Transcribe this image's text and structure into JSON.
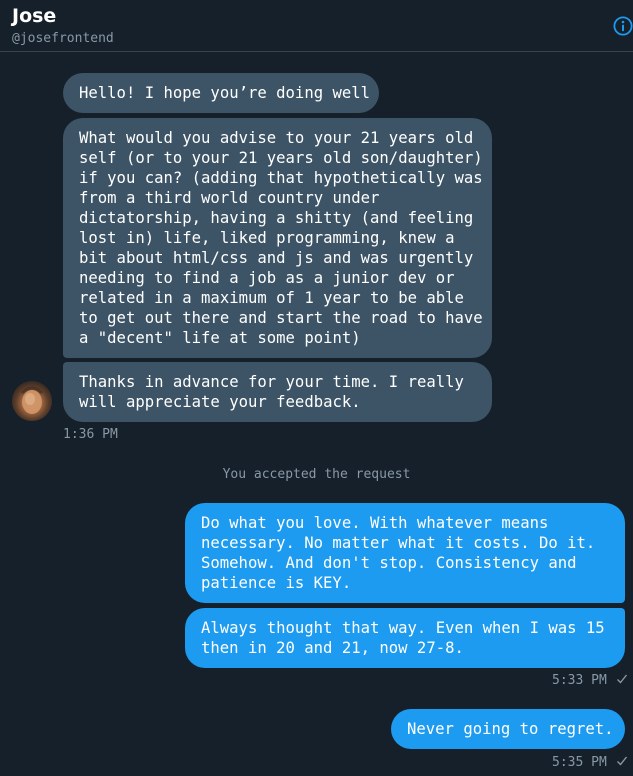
{
  "header": {
    "name": "Jose",
    "handle": "@josefrontend",
    "info_icon": "info-icon"
  },
  "incoming": {
    "messages": [
      "Hello! I hope you’re doing well",
      "What would you advise to your 21 years old\nself (or to your 21 years old son/daughter)\nif you can? (adding that hypothetically was\nfrom a third world country under\ndictatorship, having a shitty (and feeling\nlost in) life, liked programming, knew a\nbit about html/css and js and was urgently\nneeding to find a job as a junior dev or\nrelated in a maximum of 1 year to be able\nto get out there and start the road to have\na \"decent\" life at some point)",
      "Thanks in advance for your time. I really\nwill appreciate your feedback."
    ],
    "timestamp": "1:36 PM"
  },
  "system_message": "You accepted the request",
  "outgoing": {
    "messages": [
      "Do what you love. With whatever means\nnecessary. No matter what it costs. Do it.\nSomehow. And don't stop. Consistency and\npatience is KEY.",
      "Always thought that way. Even when I was 15\nthen in 20 and 21, now 27-8."
    ],
    "timestamp": "5:33 PM",
    "last_message": "Never going to regret.",
    "last_timestamp": "5:35 PM"
  },
  "colors": {
    "background": "#15202b",
    "incoming_bubble": "#3d5466",
    "outgoing_bubble": "#1d9bf0",
    "muted_text": "#8899a6",
    "accent": "#1d9bf0"
  }
}
